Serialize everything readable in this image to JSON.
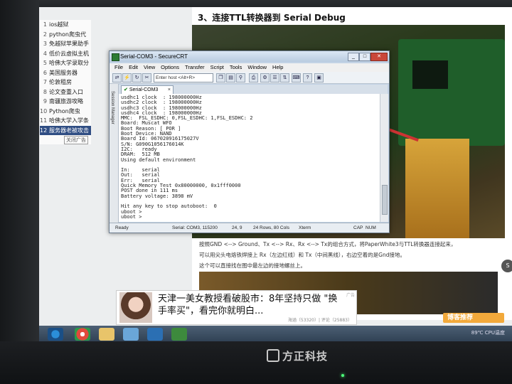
{
  "article": {
    "heading": "3、连接TTL转换器到 Serial Debug",
    "paragraph_lines": [
      "按照GND <--> Ground、Tx <--> Rx、Rx <--> Tx的组合方式，将PaperWhite3与TTL转换器连接起来，",
      "可以用尖头电烙铁焊接上 Rx（左边红线）和 Tx（中间黑线），右边空着的是Gnd接地。",
      "这个可以直接找在图中最左边的接地螺丝上。"
    ]
  },
  "sidebar": {
    "items": [
      {
        "num": "1",
        "label": "ios越狱"
      },
      {
        "num": "2",
        "label": "python爬虫代"
      },
      {
        "num": "3",
        "label": "免越狱苹果助手"
      },
      {
        "num": "4",
        "label": "低价云虚拟主机"
      },
      {
        "num": "5",
        "label": "哈佛大学录取分"
      },
      {
        "num": "6",
        "label": "美国服务器"
      },
      {
        "num": "7",
        "label": "伦敦租房"
      },
      {
        "num": "8",
        "label": "论文查重入口"
      },
      {
        "num": "9",
        "label": "南疆旅游攻略"
      },
      {
        "num": "10",
        "label": "Python爬虫"
      },
      {
        "num": "11",
        "label": "哈佛大学入学条"
      },
      {
        "num": "12",
        "label": "服务器老被攻击"
      }
    ],
    "close_label": "关闭广告"
  },
  "securecrt": {
    "title": "Serial-COM3 - SecureCRT",
    "menu": [
      "File",
      "Edit",
      "View",
      "Options",
      "Transfer",
      "Script",
      "Tools",
      "Window",
      "Help"
    ],
    "host_placeholder": "Enter host <Alt+R>",
    "side_label": "Session Manager",
    "tab_label": "Serial-COM3",
    "terminal_lines": [
      "usdhc1 clock  : 198000000Hz",
      "usdhc2 clock  : 198000000Hz",
      "usdhc3 clock  : 198000000Hz",
      "usdhc4 clock  : 198000000Hz",
      "MMC:  FSL_ESDHC: 0,FSL_ESDHC: 1,FSL_ESDHC: 2",
      "Board: Muscat WFO",
      "Boot Reason: [ POR ]",
      "Boot Device: NAND",
      "Board Id: 067020916175027V",
      "S/N: G090G1056176014K",
      "I2C:   ready",
      "DRAM:  512 MB",
      "Using default environment",
      "",
      "In:    serial",
      "Out:   serial",
      "Err:   serial",
      "Quick Memory Test 0x80000000, 0x1fff0000",
      "POST done in 111 ms",
      "Battery voltage: 3898 mV",
      "",
      "Hit any key to stop autoboot:  0",
      "uboot >",
      "uboot >"
    ],
    "status": {
      "ready": "Ready",
      "port": "Serial: COM3, 115200",
      "pos": "24,  9",
      "size": "24 Rows, 80 Cols",
      "term": "Xterm",
      "caps": "CAP",
      "num": "NUM"
    }
  },
  "ad": {
    "text_line1": "天津一美女教授看破股市：8年坚持只做 \"换",
    "text_line2": "手率买\"，看完你就明白...",
    "meta": "海涵（53320）| 评论（25883）",
    "tag": "广告"
  },
  "taskbar": {
    "badge": "博客推荐",
    "clock": "89℃ CPU温度"
  },
  "monitor": {
    "brand": "方正科技"
  },
  "colors": {
    "sidebar_active": "#2f4d83",
    "window_frame": "#c3d3e5",
    "taskbar": "#2e3f52"
  }
}
